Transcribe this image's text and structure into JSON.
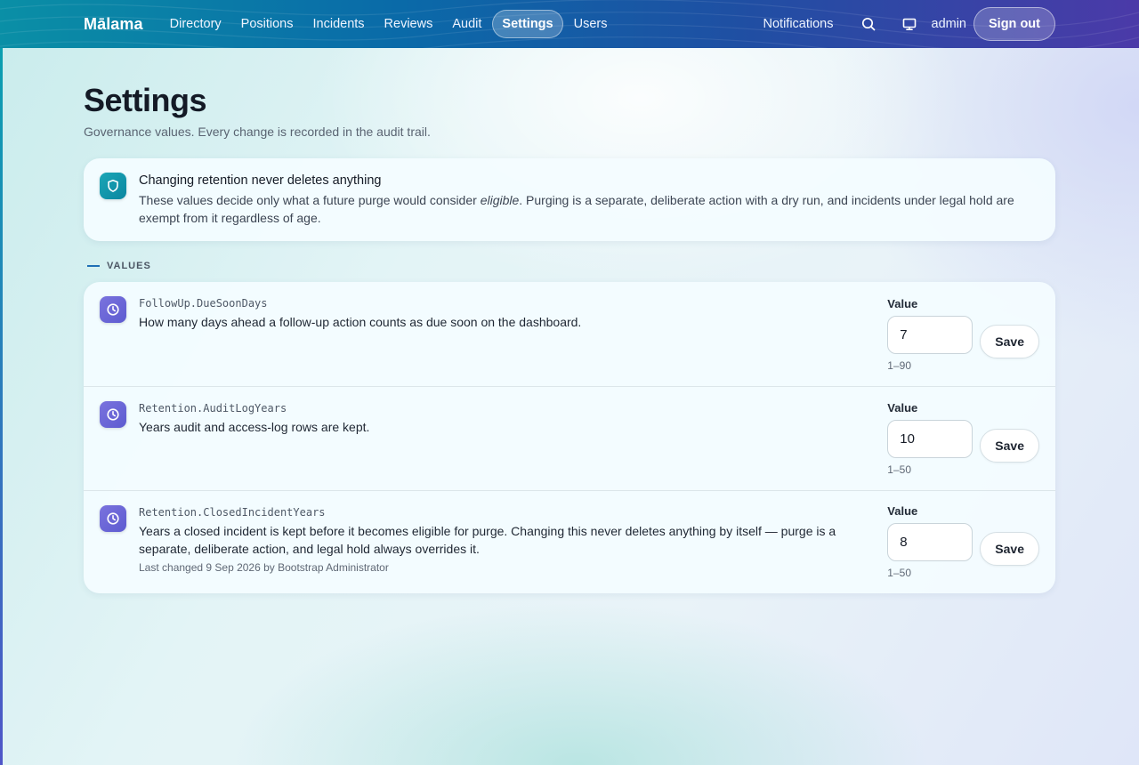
{
  "app": {
    "brand": "Mālama"
  },
  "nav": {
    "items": [
      {
        "label": "Directory"
      },
      {
        "label": "Positions"
      },
      {
        "label": "Incidents"
      },
      {
        "label": "Reviews"
      },
      {
        "label": "Audit"
      },
      {
        "label": "Settings",
        "active": true
      },
      {
        "label": "Users"
      }
    ],
    "notifications_label": "Notifications",
    "user_name": "admin",
    "sign_out_label": "Sign out"
  },
  "page": {
    "title": "Settings",
    "subtitle": "Governance values. Every change is recorded in the audit trail."
  },
  "notice": {
    "title": "Changing retention never deletes anything",
    "body_before": "These values decide only what a future purge would consider ",
    "body_emphasis": "eligible",
    "body_after": ". Purging is a separate, deliberate action with a dry run, and incidents under legal hold are exempt from it regardless of age."
  },
  "section": {
    "label": "VALUES"
  },
  "settings": [
    {
      "key": "FollowUp.DueSoonDays",
      "description": "How many days ahead a follow-up action counts as due soon on the dashboard.",
      "meta": "",
      "value_label": "Value",
      "value": "7",
      "range": "1–90",
      "save_label": "Save"
    },
    {
      "key": "Retention.AuditLogYears",
      "description": "Years audit and access-log rows are kept.",
      "meta": "",
      "value_label": "Value",
      "value": "10",
      "range": "1–50",
      "save_label": "Save"
    },
    {
      "key": "Retention.ClosedIncidentYears",
      "description": "Years a closed incident is kept before it becomes eligible for purge. Changing this never deletes anything by itself — purge is a separate, deliberate action, and legal hold always overrides it.",
      "meta": "Last changed 9 Sep 2026 by Bootstrap Administrator",
      "value_label": "Value",
      "value": "8",
      "range": "1–50",
      "save_label": "Save"
    }
  ],
  "icons": {
    "notice": "shield-icon",
    "setting": "clock-icon",
    "search": "search-icon",
    "display": "monitor-icon"
  },
  "colors": {
    "topbar_start": "#0a8fa6",
    "topbar_end": "#4b3aa8",
    "notice_badge": "#1aa6b6",
    "setting_badge": "#6b67d8"
  }
}
